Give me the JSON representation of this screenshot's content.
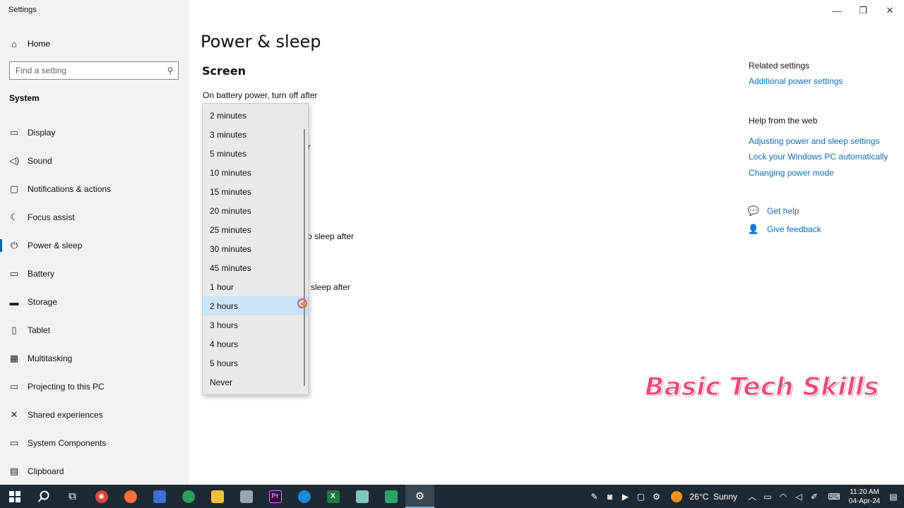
{
  "window": {
    "title": "Settings",
    "controls": {
      "minimize": "—",
      "restore": "❐",
      "close": "✕"
    }
  },
  "sidebar": {
    "home_label": "Home",
    "search_placeholder": "Find a setting",
    "section": "System",
    "items": [
      {
        "label": "Display",
        "icon": "display-icon",
        "glyph": "▭"
      },
      {
        "label": "Sound",
        "icon": "sound-icon",
        "glyph": "🔈"
      },
      {
        "label": "Notifications & actions",
        "icon": "notifications-icon",
        "glyph": "▢"
      },
      {
        "label": "Focus assist",
        "icon": "focus-assist-icon",
        "glyph": "☾"
      },
      {
        "label": "Power & sleep",
        "icon": "power-icon",
        "glyph": "⏻"
      },
      {
        "label": "Battery",
        "icon": "battery-icon",
        "glyph": "▭"
      },
      {
        "label": "Storage",
        "icon": "storage-icon",
        "glyph": "▬"
      },
      {
        "label": "Tablet",
        "icon": "tablet-icon",
        "glyph": "▯"
      },
      {
        "label": "Multitasking",
        "icon": "multitasking-icon",
        "glyph": "▦"
      },
      {
        "label": "Projecting to this PC",
        "icon": "projecting-icon",
        "glyph": "▭"
      },
      {
        "label": "Shared experiences",
        "icon": "shared-experiences-icon",
        "glyph": "✕"
      },
      {
        "label": "System Components",
        "icon": "system-components-icon",
        "glyph": "▭"
      },
      {
        "label": "Clipboard",
        "icon": "clipboard-icon",
        "glyph": "▤"
      }
    ]
  },
  "main": {
    "title": "Power & sleep",
    "section": "Screen",
    "battery_screen_label": "On battery power, turn off after",
    "partial_labels": {
      "plugged_screen": "er",
      "battery_sleep": "o sleep after",
      "plugged_sleep": "sleep after"
    }
  },
  "dropdown": {
    "options": [
      "2 minutes",
      "3 minutes",
      "5 minutes",
      "10 minutes",
      "15 minutes",
      "20 minutes",
      "25 minutes",
      "30 minutes",
      "45 minutes",
      "1 hour",
      "2 hours",
      "3 hours",
      "4 hours",
      "5 hours",
      "Never"
    ],
    "selected": "2 hours"
  },
  "related": {
    "heading": "Related settings",
    "link": "Additional power settings",
    "web_heading": "Help from the web",
    "web_links": [
      "Adjusting power and sleep settings",
      "Lock your Windows PC automatically",
      "Changing power mode"
    ],
    "get_help": "Get help",
    "give_feedback": "Give feedback"
  },
  "watermark": "Basic Tech Skills",
  "taskbar": {
    "weather_temp": "26°C",
    "weather_desc": "Sunny",
    "time": "11:20 AM",
    "date": "04-Apr-24"
  },
  "colors": {
    "accent": "#0a6fb6",
    "selection": "#cce4f7",
    "taskbar": "#1e2a33",
    "watermark": "#e8497a"
  }
}
